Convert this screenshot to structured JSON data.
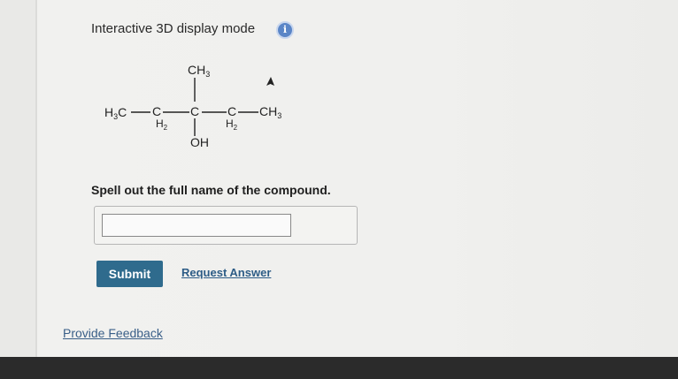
{
  "display_mode": {
    "label": "Interactive 3D display mode",
    "info_icon": "i"
  },
  "molecule": {
    "left_methyl": {
      "main": "H",
      "sub": "3",
      "tail": "C"
    },
    "ch2_a": {
      "c": "C",
      "h": "H",
      "sub": "2"
    },
    "center_carbon": "C",
    "top_methyl": {
      "main": "CH",
      "sub": "3"
    },
    "hydroxyl": "OH",
    "ch2_b": {
      "c": "C",
      "h": "H",
      "sub": "2"
    },
    "right_methyl": {
      "main": "CH",
      "sub": "3"
    }
  },
  "question": "Spell out the full name of the compound.",
  "answer": {
    "value": "",
    "placeholder": ""
  },
  "submit_label": "Submit",
  "request_answer_label": "Request Answer",
  "feedback_label": "Provide Feedback",
  "icons": [
    "info-icon",
    "mouse-cursor-icon"
  ],
  "colors": {
    "accent": "#2f6b8d",
    "link": "#2d5c86",
    "info": "#5b86c7"
  }
}
